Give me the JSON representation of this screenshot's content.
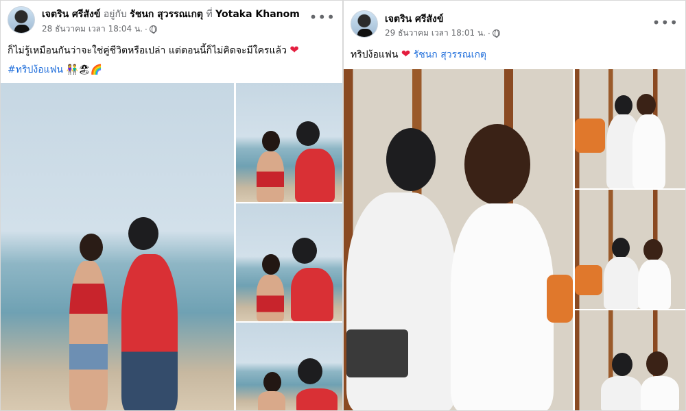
{
  "left_post": {
    "author": "เจตริน ศรีสังข์",
    "with_text": "อยู่กับ",
    "tagged": "รัชนก สุวรรณเกตุ",
    "at_text": "ที่",
    "location": "Yotaka Khanom",
    "date": "28 ธันวาคม เวลา 18:04 น.",
    "caption": "ก็ไม่รู้เหมือนกันว่าจะใช่คู่ชีวิตหรือเปล่า แต่ตอนนี้ก็ไม่คิดจะมีใครแล้ว",
    "hashtag": "#ทริปง้อแฟน",
    "emojis": "👫🏖🌈"
  },
  "right_post": {
    "author": "เจตริน ศรีสังข์",
    "date": "29 ธันวาคม เวลา 18:01 น.",
    "caption": "ทริปง้อแฟน",
    "tagged": "รัชนก สุวรรณเกตุ"
  },
  "icons": {
    "heart": "❤",
    "more": "•••",
    "dot": "·"
  },
  "colors": {
    "link": "#216fdb",
    "heart": "#e41e3f",
    "muted": "#65676b"
  }
}
